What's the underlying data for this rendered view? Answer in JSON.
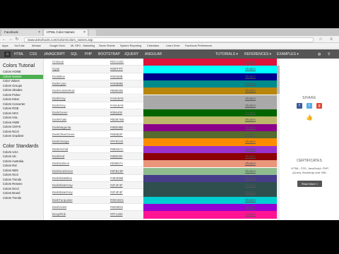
{
  "browser": {
    "tabs": [
      {
        "label": "Facebook"
      },
      {
        "label": "HTML Color Names"
      },
      {
        "label": ""
      }
    ],
    "url": "www.w3schools.com/colors/colors_names.asp",
    "bookmarks": [
      "Apps",
      "YouTube",
      "Airbase",
      "Google Drive",
      "ML SEO - Marketing",
      "Same Sheets",
      "System Reporting",
      "Calendars",
      "Learn Drive",
      "Facebook Preferences"
    ]
  },
  "topnav": {
    "home_icon": "home-icon",
    "left": [
      "HTML",
      "CSS",
      "JAVASCRIPT",
      "SQL",
      "PHP",
      "BOOTSTRAP",
      "JQUERY",
      "ANGULAR"
    ],
    "right": [
      "TUTORIALS ▾",
      "REFERENCES ▾",
      "EXAMPLES ▾"
    ]
  },
  "sidebar": {
    "heading1": "Colors Tutorial",
    "group1": [
      "Colors HOME",
      "Colors Names",
      "Color Values",
      "Colors Groups",
      "Colors Shades",
      "Colors Picker",
      "Colors Mixer",
      "Colors Converter",
      "Colors RGB",
      "Colors HEX",
      "Colors HSL",
      "Colors HWB",
      "Colors CMYK",
      "Colors NCol",
      "Colors Gradient"
    ],
    "selected": 1,
    "heading2": "Color Standards",
    "group2": [
      "Colors USA",
      "Colors UK",
      "Colors Australia",
      "Colors Ral",
      "Colors NBS",
      "Colors NCS",
      "Colors Trends",
      "Colors Resene",
      "Colors NCol",
      "Colors Brand",
      "Colors Trends"
    ]
  },
  "table": {
    "shades_label": "Shades",
    "rows": [
      {
        "name": "Crimson",
        "hex": "#DC143C",
        "color": "#DC143C"
      },
      {
        "name": "Cyan",
        "hex": "#00FFFF",
        "color": "#00FFFF"
      },
      {
        "name": "DarkBlue",
        "hex": "#00008B",
        "color": "#00008B"
      },
      {
        "name": "DarkCyan",
        "hex": "#008B8B",
        "color": "#008B8B"
      },
      {
        "name": "DarkGoldenRod",
        "hex": "#B8860B",
        "color": "#B8860B"
      },
      {
        "name": "DarkGray",
        "hex": "#A9A9A9",
        "color": "#A9A9A9"
      },
      {
        "name": "DarkGrey",
        "hex": "#A9A9A9",
        "color": "#A9A9A9"
      },
      {
        "name": "DarkGreen",
        "hex": "#006400",
        "color": "#006400"
      },
      {
        "name": "DarkKhaki",
        "hex": "#BDB76B",
        "color": "#BDB76B"
      },
      {
        "name": "DarkMagenta",
        "hex": "#8B008B",
        "color": "#8B008B"
      },
      {
        "name": "DarkOliveGreen",
        "hex": "#556B2F",
        "color": "#556B2F"
      },
      {
        "name": "DarkOrange",
        "hex": "#FF8C00",
        "color": "#FF8C00"
      },
      {
        "name": "DarkOrchid",
        "hex": "#9932CC",
        "color": "#9932CC"
      },
      {
        "name": "DarkRed",
        "hex": "#8B0000",
        "color": "#8B0000"
      },
      {
        "name": "DarkSalmon",
        "hex": "#E9967A",
        "color": "#E9967A"
      },
      {
        "name": "DarkSeaGreen",
        "hex": "#8FBC8F",
        "color": "#8FBC8F"
      },
      {
        "name": "DarkSlateBlue",
        "hex": "#483D8B",
        "color": "#483D8B"
      },
      {
        "name": "DarkSlateGray",
        "hex": "#2F4F4F",
        "color": "#2F4F4F"
      },
      {
        "name": "DarkSlateGrey",
        "hex": "#2F4F4F",
        "color": "#2F4F4F"
      },
      {
        "name": "DarkTurquoise",
        "hex": "#00CED1",
        "color": "#00CED1"
      },
      {
        "name": "DarkViolet",
        "hex": "#9400D3",
        "color": "#9400D3"
      },
      {
        "name": "DeepPink",
        "hex": "#FF1493",
        "color": "#FF1493"
      }
    ]
  },
  "right_panel": {
    "share_title": "SHARE",
    "share_icons": [
      "facebook-icon",
      "twitter-icon",
      "google-plus-icon"
    ],
    "like_icon": "thumbs-up-icon",
    "cert_title": "CERTIFICATES",
    "cert_desc": "HTML, CSS, JavaScript, PHP, jQuery, Bootstrap and XML.",
    "read_more": "Read More »"
  },
  "colors": {
    "accent": "#4caf50",
    "nav_bg": "#555555"
  }
}
